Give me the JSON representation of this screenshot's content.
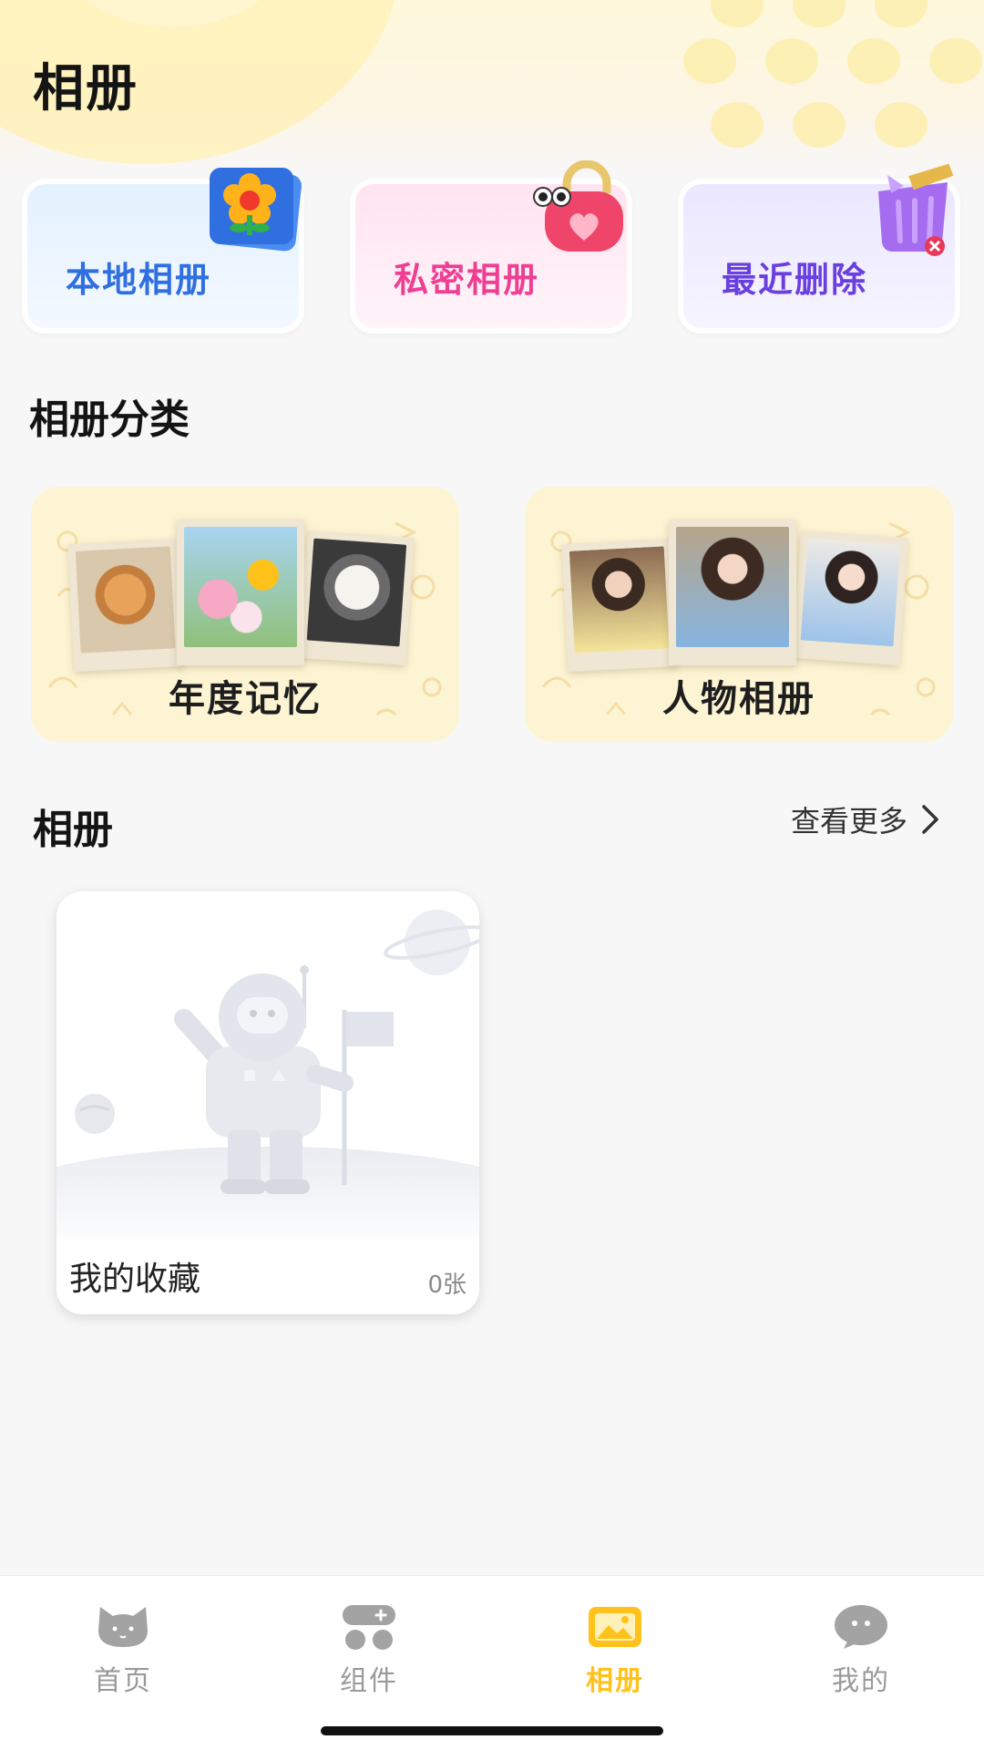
{
  "header": {
    "title": "相册"
  },
  "quick_albums": [
    {
      "label": "本地相册",
      "icon": "flower-photo-icon",
      "color": "#2f6fe0"
    },
    {
      "label": "私密相册",
      "icon": "heart-lock-icon",
      "color": "#ee3f93"
    },
    {
      "label": "最近删除",
      "icon": "trash-bin-icon",
      "color": "#6a3fe0"
    }
  ],
  "categories": {
    "title": "相册分类",
    "items": [
      {
        "label": "年度记忆",
        "icon": "pets-flowers-photos"
      },
      {
        "label": "人物相册",
        "icon": "people-photos"
      }
    ]
  },
  "albums": {
    "title": "相册",
    "more_label": "查看更多",
    "items": [
      {
        "name": "我的收藏",
        "count": "0张",
        "thumbnail": "astronaut-empty-illustration"
      }
    ]
  },
  "tabbar": {
    "active": "相册",
    "active_color": "#ffc21a",
    "tabs": [
      {
        "label": "首页",
        "icon": "cat-head-icon"
      },
      {
        "label": "组件",
        "icon": "widgets-icon"
      },
      {
        "label": "相册",
        "icon": "picture-icon"
      },
      {
        "label": "我的",
        "icon": "face-bubble-icon"
      }
    ]
  }
}
